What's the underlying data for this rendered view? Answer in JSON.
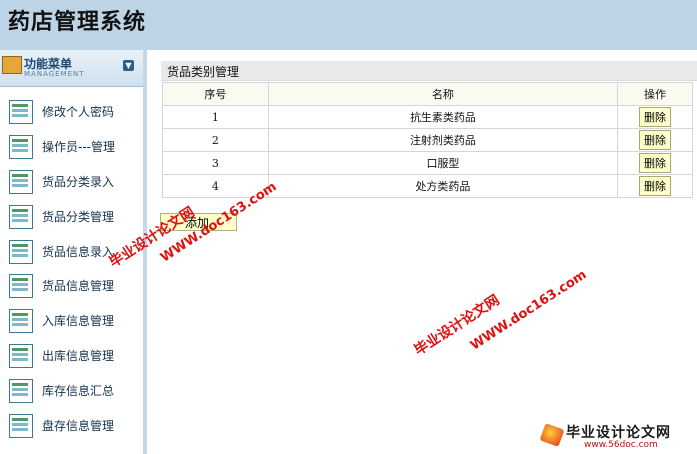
{
  "header": {
    "title": "药店管理系统"
  },
  "sidebar": {
    "menu_title": "功能菜单",
    "menu_subtitle": "MANAGEMENT",
    "items": [
      {
        "label": "修改个人密码"
      },
      {
        "label": "操作员---管理"
      },
      {
        "label": "货品分类录入"
      },
      {
        "label": "货品分类管理"
      },
      {
        "label": "货品信息录入"
      },
      {
        "label": "货品信息管理"
      },
      {
        "label": "入库信息管理"
      },
      {
        "label": "出库信息管理"
      },
      {
        "label": "库存信息汇总"
      },
      {
        "label": "盘存信息管理"
      }
    ]
  },
  "main": {
    "panel_title": "货品类别管理",
    "columns": [
      "序号",
      "名称",
      "操作"
    ],
    "rows": [
      {
        "no": "1",
        "name": "抗生素类药品",
        "action": "删除"
      },
      {
        "no": "2",
        "name": "注射剂类药品",
        "action": "删除"
      },
      {
        "no": "3",
        "name": "口服型",
        "action": "删除"
      },
      {
        "no": "4",
        "name": "处方类药品",
        "action": "删除"
      }
    ],
    "add_label": "添加"
  },
  "watermarks": {
    "cn": "毕业设计论文网",
    "url": "WWW.doc163.com"
  },
  "logo": {
    "main": "毕业设计论文网",
    "url": "www.56doc.com"
  }
}
